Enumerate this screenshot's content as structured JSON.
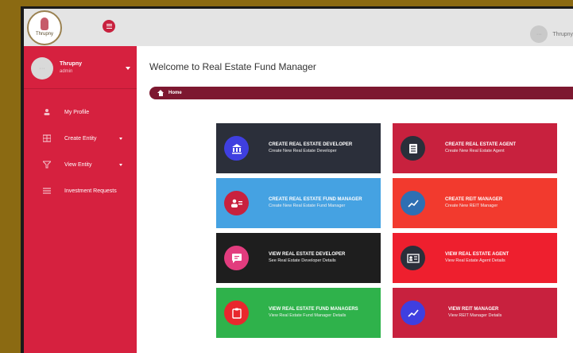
{
  "header": {
    "logo_text": "Thrupny",
    "user_name": "Thrupny"
  },
  "sidebar": {
    "profile_name": "Thrupny",
    "profile_role": "admin",
    "items": [
      {
        "label": "My Profile"
      },
      {
        "label": "Create Entity"
      },
      {
        "label": "View Entity"
      },
      {
        "label": "Investment Requests"
      }
    ]
  },
  "main": {
    "title": "Welcome to Real Estate Fund Manager",
    "breadcrumb": "Home"
  },
  "tiles": [
    {
      "title": "CREATE REAL ESTATE DEVELOPER",
      "subtitle": "Create New Real Estate Developer",
      "bg": "#2b2f3a",
      "icon_bg": "#3f3fe0"
    },
    {
      "title": "CREATE REAL ESTATE AGENT",
      "subtitle": "Create New Real Estate Agent",
      "bg": "#c8213e",
      "icon_bg": "#2b2f3a"
    },
    {
      "title": "CREATE REAL ESTATE FUND MANAGER",
      "subtitle": "Create New Real Estate Fund Manager",
      "bg": "#45a2e2",
      "icon_bg": "#c8213e"
    },
    {
      "title": "CREATE REIT MANAGER",
      "subtitle": "Create New REIT Manager",
      "bg": "#f23a2e",
      "icon_bg": "#2e6fb3"
    },
    {
      "title": "VIEW REAL ESTATE DEVELOPER",
      "subtitle": "See Real Estate Developer Details",
      "bg": "#1e1e1e",
      "icon_bg": "#e23c7e"
    },
    {
      "title": "VIEW REAL ESTATE AGENT",
      "subtitle": "View Real Estate Agent Details",
      "bg": "#ee1f2e",
      "icon_bg": "#2b2f3a"
    },
    {
      "title": "VIEW REAL ESTATE FUND MANAGERS",
      "subtitle": "View Real Estate Fund Manager Details",
      "bg": "#2fb24b",
      "icon_bg": "#e8272d"
    },
    {
      "title": "VIEW REIT MANAGER",
      "subtitle": "View REIT Manager Details",
      "bg": "#c8213e",
      "icon_bg": "#3f3fe0"
    }
  ],
  "icons": {
    "tile_icons": [
      "bank-icon",
      "document-icon",
      "users-icon",
      "chart-line-icon",
      "chat-icon",
      "id-card-icon",
      "clipboard-icon",
      "chart-line-icon"
    ]
  }
}
